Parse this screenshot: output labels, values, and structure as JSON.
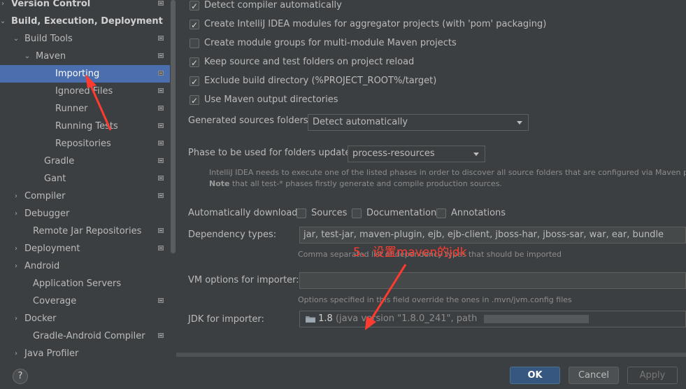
{
  "sidebar": {
    "items": [
      {
        "label": "Version Control",
        "arrow": "›",
        "bold": true,
        "badge": true
      },
      {
        "label": "Build, Execution, Deployment",
        "arrow": "⌄",
        "bold": true,
        "badge": false
      },
      {
        "label": "Build Tools",
        "arrow": "⌄",
        "badge": true
      },
      {
        "label": "Maven",
        "arrow": "⌄",
        "badge": true
      },
      {
        "label": "Importing",
        "selected": true,
        "badge": true
      },
      {
        "label": "Ignored Files",
        "badge": true
      },
      {
        "label": "Runner",
        "badge": true
      },
      {
        "label": "Running Tests",
        "badge": true
      },
      {
        "label": "Repositories",
        "badge": true
      },
      {
        "label": "Gradle",
        "badge": true
      },
      {
        "label": "Gant",
        "badge": true
      },
      {
        "label": "Compiler",
        "arrow": "›",
        "badge": true
      },
      {
        "label": "Debugger",
        "arrow": "›",
        "badge": false
      },
      {
        "label": "Remote Jar Repositories",
        "badge": true
      },
      {
        "label": "Deployment",
        "arrow": "›",
        "badge": true
      },
      {
        "label": "Android",
        "arrow": "›",
        "badge": false
      },
      {
        "label": "Application Servers",
        "badge": false
      },
      {
        "label": "Coverage",
        "badge": true
      },
      {
        "label": "Docker",
        "arrow": "›",
        "badge": false
      },
      {
        "label": "Gradle-Android Compiler",
        "badge": true
      },
      {
        "label": "Java Profiler",
        "arrow": "›",
        "badge": false
      }
    ]
  },
  "checkboxes": [
    {
      "label": "Detect compiler automatically",
      "checked": true
    },
    {
      "label": "Create IntelliJ IDEA modules for aggregator projects (with 'pom' packaging)",
      "checked": true
    },
    {
      "label": "Create module groups for multi-module Maven projects",
      "checked": false
    },
    {
      "label": "Keep source and test folders on project reload",
      "checked": true
    },
    {
      "label": "Exclude build directory (%PROJECT_ROOT%/target)",
      "checked": true
    },
    {
      "label": "Use Maven output directories",
      "checked": true
    }
  ],
  "generated_sources": {
    "label": "Generated sources folders:",
    "value": "Detect automatically"
  },
  "phase": {
    "label": "Phase to be used for folders update:",
    "value": "process-resources",
    "hint_line1": "IntelliJ IDEA needs to execute one of the listed phases in order to discover all source folders that are configured via Maven plugins.",
    "hint_note_bold": "Note",
    "hint_line2": " that all test-* phases firstly generate and compile production sources."
  },
  "auto_download": {
    "label": "Automatically download:",
    "options": [
      {
        "label": "Sources",
        "checked": false
      },
      {
        "label": "Documentation",
        "checked": false
      },
      {
        "label": "Annotations",
        "checked": false
      }
    ]
  },
  "dependency_types": {
    "label": "Dependency types:",
    "value": "jar, test-jar, maven-plugin, ejb, ejb-client, jboss-har, jboss-sar, war, ear, bundle",
    "hint": "Comma separated list of dependency types that should be imported"
  },
  "vm_options": {
    "label": "VM options for importer:",
    "value": "",
    "hint": "Options specified in this field override the ones in .mvn/jvm.config files"
  },
  "jdk": {
    "label": "JDK for importer:",
    "version": "1.8",
    "details": "(java version \"1.8.0_241\", path"
  },
  "annotation": {
    "text": "5、设置maven的jdk",
    "color": "#ff3b30"
  },
  "buttons": {
    "help": "?",
    "ok": "OK",
    "cancel": "Cancel",
    "apply": "Apply"
  }
}
